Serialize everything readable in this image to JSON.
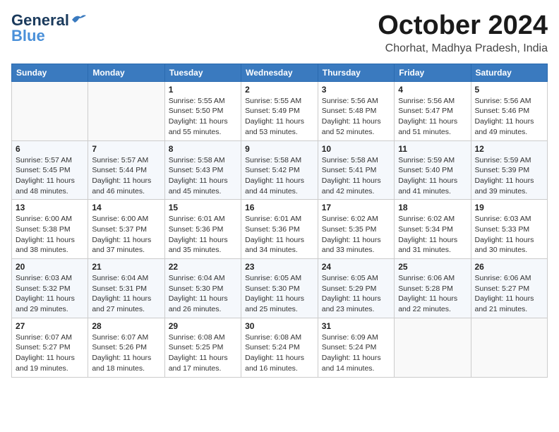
{
  "logo": {
    "line1": "General",
    "line2": "Blue"
  },
  "header": {
    "month_title": "October 2024",
    "subtitle": "Chorhat, Madhya Pradesh, India"
  },
  "columns": [
    "Sunday",
    "Monday",
    "Tuesday",
    "Wednesday",
    "Thursday",
    "Friday",
    "Saturday"
  ],
  "weeks": [
    [
      {
        "day": "",
        "detail": ""
      },
      {
        "day": "",
        "detail": ""
      },
      {
        "day": "1",
        "detail": "Sunrise: 5:55 AM\nSunset: 5:50 PM\nDaylight: 11 hours and 55 minutes."
      },
      {
        "day": "2",
        "detail": "Sunrise: 5:55 AM\nSunset: 5:49 PM\nDaylight: 11 hours and 53 minutes."
      },
      {
        "day": "3",
        "detail": "Sunrise: 5:56 AM\nSunset: 5:48 PM\nDaylight: 11 hours and 52 minutes."
      },
      {
        "day": "4",
        "detail": "Sunrise: 5:56 AM\nSunset: 5:47 PM\nDaylight: 11 hours and 51 minutes."
      },
      {
        "day": "5",
        "detail": "Sunrise: 5:56 AM\nSunset: 5:46 PM\nDaylight: 11 hours and 49 minutes."
      }
    ],
    [
      {
        "day": "6",
        "detail": "Sunrise: 5:57 AM\nSunset: 5:45 PM\nDaylight: 11 hours and 48 minutes."
      },
      {
        "day": "7",
        "detail": "Sunrise: 5:57 AM\nSunset: 5:44 PM\nDaylight: 11 hours and 46 minutes."
      },
      {
        "day": "8",
        "detail": "Sunrise: 5:58 AM\nSunset: 5:43 PM\nDaylight: 11 hours and 45 minutes."
      },
      {
        "day": "9",
        "detail": "Sunrise: 5:58 AM\nSunset: 5:42 PM\nDaylight: 11 hours and 44 minutes."
      },
      {
        "day": "10",
        "detail": "Sunrise: 5:58 AM\nSunset: 5:41 PM\nDaylight: 11 hours and 42 minutes."
      },
      {
        "day": "11",
        "detail": "Sunrise: 5:59 AM\nSunset: 5:40 PM\nDaylight: 11 hours and 41 minutes."
      },
      {
        "day": "12",
        "detail": "Sunrise: 5:59 AM\nSunset: 5:39 PM\nDaylight: 11 hours and 39 minutes."
      }
    ],
    [
      {
        "day": "13",
        "detail": "Sunrise: 6:00 AM\nSunset: 5:38 PM\nDaylight: 11 hours and 38 minutes."
      },
      {
        "day": "14",
        "detail": "Sunrise: 6:00 AM\nSunset: 5:37 PM\nDaylight: 11 hours and 37 minutes."
      },
      {
        "day": "15",
        "detail": "Sunrise: 6:01 AM\nSunset: 5:36 PM\nDaylight: 11 hours and 35 minutes."
      },
      {
        "day": "16",
        "detail": "Sunrise: 6:01 AM\nSunset: 5:36 PM\nDaylight: 11 hours and 34 minutes."
      },
      {
        "day": "17",
        "detail": "Sunrise: 6:02 AM\nSunset: 5:35 PM\nDaylight: 11 hours and 33 minutes."
      },
      {
        "day": "18",
        "detail": "Sunrise: 6:02 AM\nSunset: 5:34 PM\nDaylight: 11 hours and 31 minutes."
      },
      {
        "day": "19",
        "detail": "Sunrise: 6:03 AM\nSunset: 5:33 PM\nDaylight: 11 hours and 30 minutes."
      }
    ],
    [
      {
        "day": "20",
        "detail": "Sunrise: 6:03 AM\nSunset: 5:32 PM\nDaylight: 11 hours and 29 minutes."
      },
      {
        "day": "21",
        "detail": "Sunrise: 6:04 AM\nSunset: 5:31 PM\nDaylight: 11 hours and 27 minutes."
      },
      {
        "day": "22",
        "detail": "Sunrise: 6:04 AM\nSunset: 5:30 PM\nDaylight: 11 hours and 26 minutes."
      },
      {
        "day": "23",
        "detail": "Sunrise: 6:05 AM\nSunset: 5:30 PM\nDaylight: 11 hours and 25 minutes."
      },
      {
        "day": "24",
        "detail": "Sunrise: 6:05 AM\nSunset: 5:29 PM\nDaylight: 11 hours and 23 minutes."
      },
      {
        "day": "25",
        "detail": "Sunrise: 6:06 AM\nSunset: 5:28 PM\nDaylight: 11 hours and 22 minutes."
      },
      {
        "day": "26",
        "detail": "Sunrise: 6:06 AM\nSunset: 5:27 PM\nDaylight: 11 hours and 21 minutes."
      }
    ],
    [
      {
        "day": "27",
        "detail": "Sunrise: 6:07 AM\nSunset: 5:27 PM\nDaylight: 11 hours and 19 minutes."
      },
      {
        "day": "28",
        "detail": "Sunrise: 6:07 AM\nSunset: 5:26 PM\nDaylight: 11 hours and 18 minutes."
      },
      {
        "day": "29",
        "detail": "Sunrise: 6:08 AM\nSunset: 5:25 PM\nDaylight: 11 hours and 17 minutes."
      },
      {
        "day": "30",
        "detail": "Sunrise: 6:08 AM\nSunset: 5:24 PM\nDaylight: 11 hours and 16 minutes."
      },
      {
        "day": "31",
        "detail": "Sunrise: 6:09 AM\nSunset: 5:24 PM\nDaylight: 11 hours and 14 minutes."
      },
      {
        "day": "",
        "detail": ""
      },
      {
        "day": "",
        "detail": ""
      }
    ]
  ]
}
